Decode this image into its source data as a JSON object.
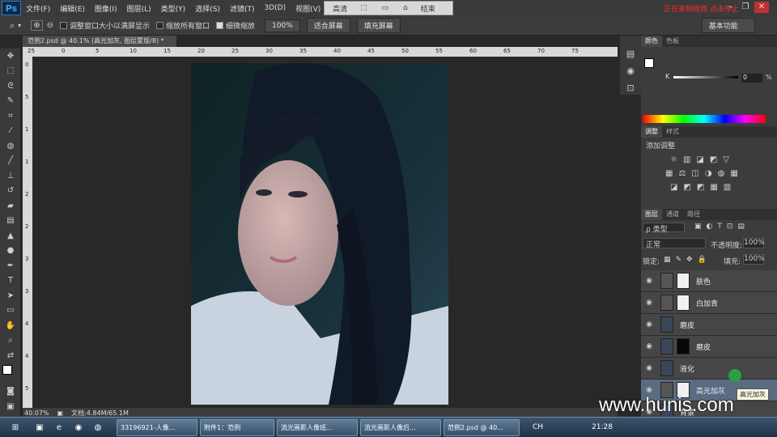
{
  "app": {
    "logo": "Ps",
    "menu": [
      "文件(F)",
      "编辑(E)",
      "图像(I)",
      "图层(L)",
      "类型(Y)",
      "选择(S)",
      "滤镜(T)",
      "3D(D)",
      "视图(V)",
      "窗口"
    ],
    "recorder": {
      "quality": "高清",
      "end": "结束"
    },
    "recording_text": "正在录制视频 点击停止",
    "window_controls": [
      "–",
      "❐",
      "✕"
    ]
  },
  "options": {
    "zoom_tool_icon": "zoom-icon",
    "resize_window_label": "调整窗口大小以满屏显示",
    "zoom_all_label": "缩放所有窗口",
    "scrubby_label": "细微缩放",
    "btn_100": "100%",
    "btn_fit": "适合屏幕",
    "btn_fill": "填充屏幕",
    "workspace": "基本功能"
  },
  "document": {
    "tab_title": "范例2.psd @ 40.1% (高光加灰, 图层蒙版/8) *",
    "ruler_top": [
      "25",
      "0",
      "5",
      "10",
      "15",
      "20",
      "25",
      "30",
      "35",
      "40",
      "45",
      "50",
      "55",
      "60",
      "65",
      "70",
      "75"
    ],
    "ruler_left": [
      "0",
      "5",
      "1",
      "1",
      "2",
      "2",
      "3",
      "3",
      "4",
      "4",
      "5"
    ],
    "zoom": "40.07%",
    "doc_info": "文档:4.84M/65.1M"
  },
  "panels": {
    "color_tabs": [
      "颜色",
      "色板"
    ],
    "k_label": "K",
    "k_value": "0",
    "k_unit": "%",
    "adjust_tabs": [
      "调整",
      "样式"
    ],
    "add_adjust": "添加调整",
    "layers_tabs": [
      "图层",
      "通道",
      "路径"
    ],
    "kind_label": "ρ 类型",
    "blend_mode": "正常",
    "opacity_label": "不透明度:",
    "opacity_value": "100%",
    "lock_label": "锁定:",
    "fill_label": "填充:",
    "fill_value": "100%",
    "layers": [
      {
        "name": "肤色",
        "selected": false
      },
      {
        "name": "白加青",
        "selected": false
      },
      {
        "name": "磨皮",
        "selected": false
      },
      {
        "name": "磨皮",
        "selected": false
      },
      {
        "name": "液化",
        "selected": false
      },
      {
        "name": "高光加灰",
        "selected": true
      },
      {
        "name": "背景",
        "selected": false
      }
    ],
    "tooltip": "高光加灰"
  },
  "watermark": "www.hunis.com",
  "taskbar": {
    "items": [
      "33196921-人像...",
      "附件1：范例",
      "流光画影人像班...",
      "流光画影人像后...",
      "范例2.psd @ 40..."
    ],
    "lang": "CH",
    "time": "21:28"
  },
  "colors": {
    "menubar": "#3a3a3a",
    "panel": "#3c3c3c",
    "selected_layer": "#5a6b82",
    "recording": "#ff2a2a"
  }
}
